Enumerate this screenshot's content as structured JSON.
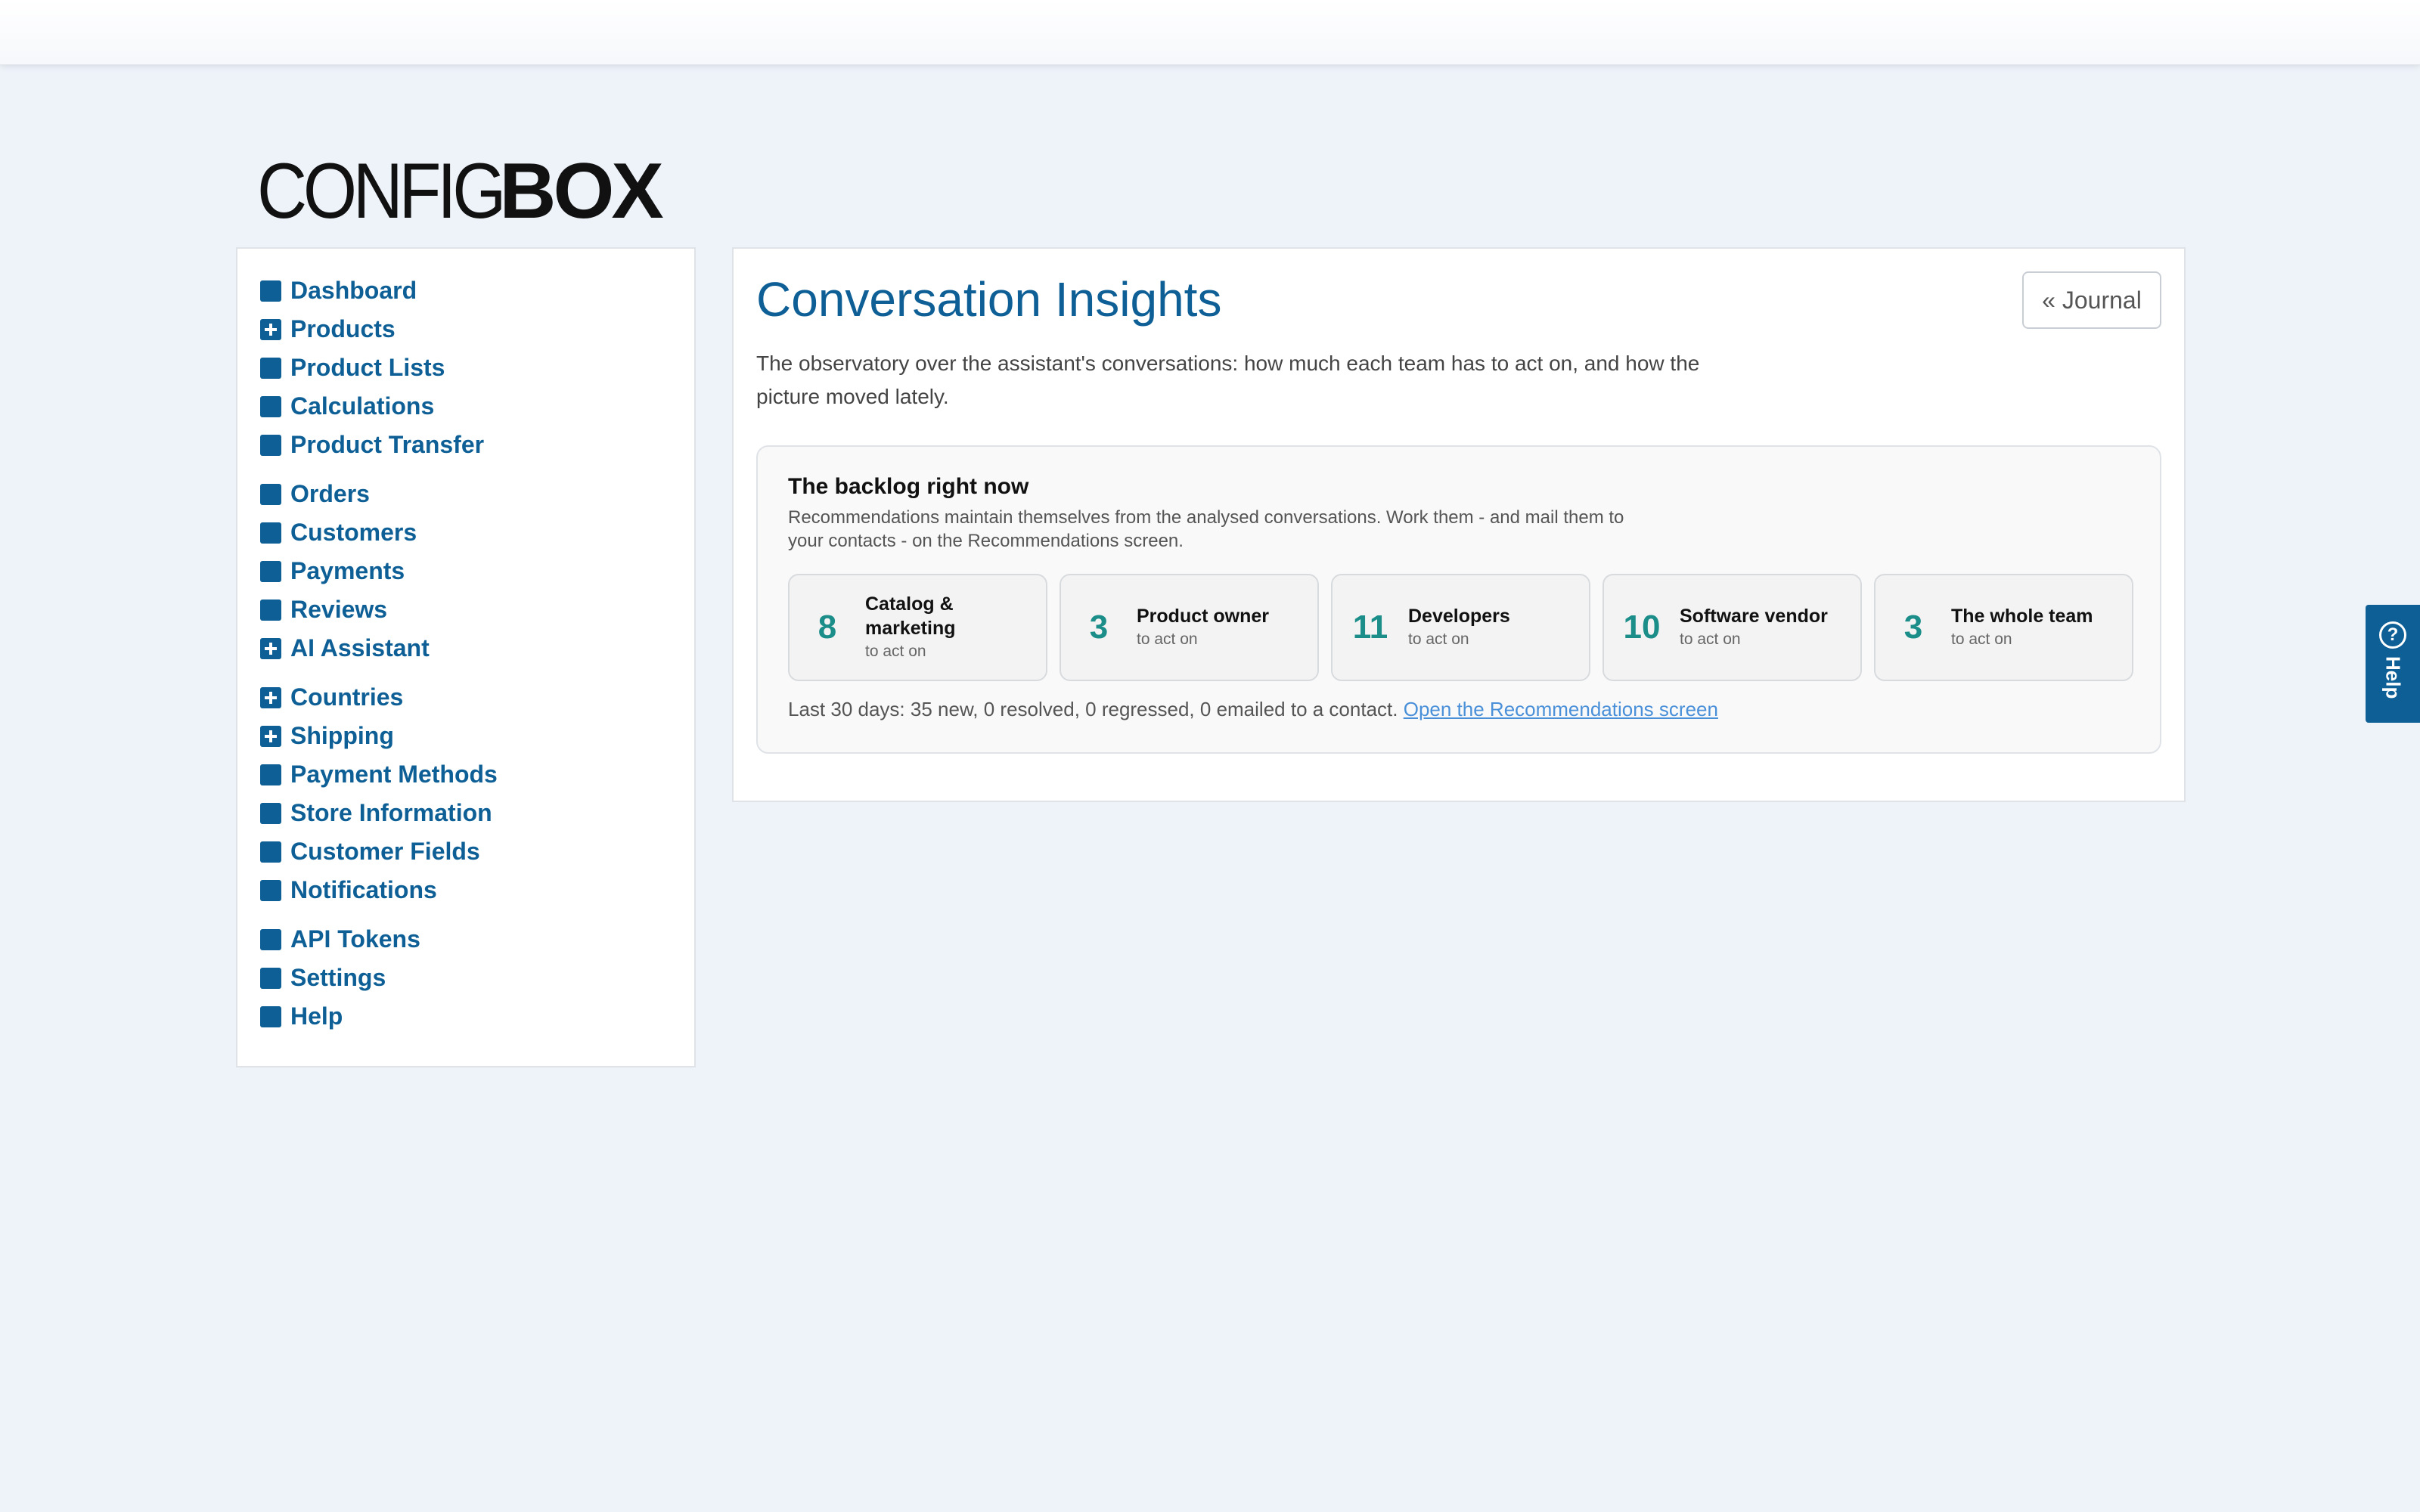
{
  "logo": {
    "part1": "CONFIG",
    "part2": "BOX"
  },
  "sidebar": {
    "groups": [
      [
        {
          "label": "Dashboard",
          "icon": "square-icon"
        },
        {
          "label": "Products",
          "icon": "plus-square-icon"
        },
        {
          "label": "Product Lists",
          "icon": "square-icon"
        },
        {
          "label": "Calculations",
          "icon": "square-icon"
        },
        {
          "label": "Product Transfer",
          "icon": "square-icon"
        }
      ],
      [
        {
          "label": "Orders",
          "icon": "square-icon"
        },
        {
          "label": "Customers",
          "icon": "square-icon"
        },
        {
          "label": "Payments",
          "icon": "square-icon"
        },
        {
          "label": "Reviews",
          "icon": "square-icon"
        },
        {
          "label": "AI Assistant",
          "icon": "plus-square-icon"
        }
      ],
      [
        {
          "label": "Countries",
          "icon": "plus-square-icon"
        },
        {
          "label": "Shipping",
          "icon": "plus-square-icon"
        },
        {
          "label": "Payment Methods",
          "icon": "square-icon"
        },
        {
          "label": "Store Information",
          "icon": "square-icon"
        },
        {
          "label": "Customer Fields",
          "icon": "square-icon"
        },
        {
          "label": "Notifications",
          "icon": "square-icon"
        }
      ],
      [
        {
          "label": "API Tokens",
          "icon": "square-icon"
        },
        {
          "label": "Settings",
          "icon": "square-icon"
        },
        {
          "label": "Help",
          "icon": "square-icon"
        }
      ]
    ]
  },
  "main": {
    "title": "Conversation Insights",
    "journal_button": "« Journal",
    "intro": "The observatory over the assistant's conversations: how much each team has to act on, and how the picture moved lately.",
    "backlog": {
      "title": "The backlog right now",
      "description": "Recommendations maintain themselves from the analysed conversations. Work them - and mail them to your contacts - on the Recommendations screen.",
      "cards": [
        {
          "count": "8",
          "name": "Catalog & marketing",
          "sub": "to act on"
        },
        {
          "count": "3",
          "name": "Product owner",
          "sub": "to act on"
        },
        {
          "count": "11",
          "name": "Developers",
          "sub": "to act on"
        },
        {
          "count": "10",
          "name": "Software vendor",
          "sub": "to act on"
        },
        {
          "count": "3",
          "name": "The whole team",
          "sub": "to act on"
        }
      ],
      "summary": "Last 30 days: 35 new, 0 resolved, 0 regressed, 0 emailed to a contact.",
      "link": "Open the Recommendations screen"
    }
  },
  "help_tab": {
    "label": "Help",
    "icon": "question-circle-icon"
  },
  "colors": {
    "brand": "#0d5f96",
    "accent_count": "#1b8e8a",
    "link": "#4a90d9",
    "background": "#eef3fa"
  }
}
